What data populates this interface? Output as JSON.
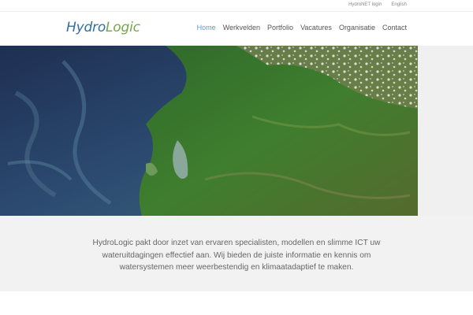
{
  "toplinks": {
    "login": "HydroNET login",
    "language": "English"
  },
  "logo": {
    "part1": "Hydro",
    "part2": "Logic"
  },
  "nav": [
    {
      "label": "Home",
      "active": true
    },
    {
      "label": "Werkvelden"
    },
    {
      "label": "Portfolio"
    },
    {
      "label": "Vacatures"
    },
    {
      "label": "Organisatie"
    },
    {
      "label": "Contact"
    }
  ],
  "intro": {
    "text": "HydroLogic pakt door inzet van ervaren specialisten, modellen en slimme ICT uw wateruitdagingen effectief aan. Wij bieden de juiste informatie en kennis om watersystemen meer weerbestendig en klimaatadaptief te maken."
  },
  "colors": {
    "nav_active": "#5b9bd5",
    "logo_blue": "#2f6fa6",
    "logo_green": "#73a64a",
    "text": "#666666"
  }
}
